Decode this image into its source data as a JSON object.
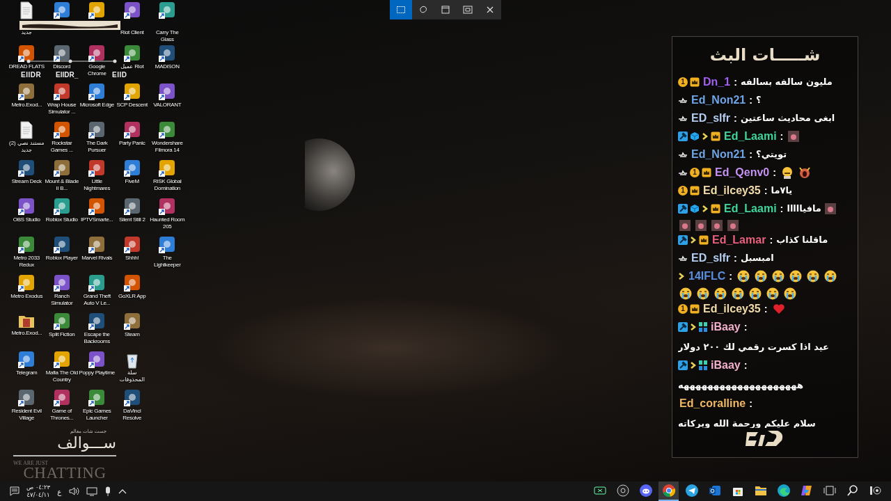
{
  "snip_toolbar": [
    {
      "kind": "rectangle",
      "selected": true
    },
    {
      "kind": "freeform",
      "selected": false
    },
    {
      "kind": "window",
      "selected": false
    },
    {
      "kind": "fullscreen",
      "selected": false
    },
    {
      "kind": "close",
      "selected": false
    }
  ],
  "desktop_rows": [
    [
      {
        "kind": "file",
        "label": "جديد"
      },
      {
        "kind": "app"
      },
      {
        "kind": "app"
      },
      {
        "kind": "app",
        "label": "Riot Client"
      },
      {
        "kind": "app",
        "label": "Carry The Glass"
      }
    ],
    [
      {
        "kind": "app",
        "label": "DREAD FLATS"
      },
      {
        "kind": "app",
        "label": "Discord"
      },
      {
        "kind": "app",
        "label": "Google Chrome"
      },
      {
        "kind": "app",
        "label": "عميل Riot"
      },
      {
        "kind": "app",
        "label": "MADiSON"
      }
    ],
    [
      {
        "kind": "app",
        "label": "Metro.Exod..."
      },
      {
        "kind": "app",
        "label": "Wrap House Simulator ..."
      },
      {
        "kind": "app",
        "label": "Microsoft Edge"
      },
      {
        "kind": "app",
        "label": "SCP Descent"
      },
      {
        "kind": "app",
        "label": "VALORANT"
      }
    ],
    [
      {
        "kind": "file",
        "label": "مستند نصي (2) جديد"
      },
      {
        "kind": "app",
        "label": "Rockstar Games ..."
      },
      {
        "kind": "app",
        "label": "The Dark Pursuer"
      },
      {
        "kind": "app",
        "label": "Party Panic"
      },
      {
        "kind": "app",
        "label": "Wondershare Filmora 14"
      }
    ],
    [
      {
        "kind": "app",
        "label": "Stream Deck"
      },
      {
        "kind": "app",
        "label": "Mount & Blade II B..."
      },
      {
        "kind": "app",
        "label": "Little Nightmares"
      },
      {
        "kind": "app",
        "label": "FiveM"
      },
      {
        "kind": "app",
        "label": "RISK Global Domination"
      }
    ],
    [
      {
        "kind": "app",
        "label": "OBS Studio"
      },
      {
        "kind": "app",
        "label": "Roblox Studio"
      },
      {
        "kind": "app",
        "label": "IPTVSmarte..."
      },
      {
        "kind": "app",
        "label": "Silent Still 2"
      },
      {
        "kind": "app",
        "label": "Haunted Room  205"
      }
    ],
    [
      {
        "kind": "app",
        "label": "Metro 2033 Redux"
      },
      {
        "kind": "app",
        "label": "Roblox Player"
      },
      {
        "kind": "app",
        "label": "Marvel Rivals"
      },
      {
        "kind": "app",
        "label": "Shhh!"
      },
      {
        "kind": "app",
        "label": "The Lightkeeper"
      }
    ],
    [
      {
        "kind": "app",
        "label": "Metro Exodus"
      },
      {
        "kind": "app",
        "label": "Ranch Simulator"
      },
      {
        "kind": "app",
        "label": "Grand Theft Auto V Le..."
      },
      {
        "kind": "app",
        "label": "GoXLR App"
      }
    ],
    [
      {
        "kind": "folder",
        "label": "Metro.Exod..."
      },
      {
        "kind": "app",
        "label": "Split Fiction"
      },
      {
        "kind": "app",
        "label": "Escape the Backrooms"
      },
      {
        "kind": "app",
        "label": "Steam"
      }
    ],
    [
      {
        "kind": "app",
        "label": "Telegram"
      },
      {
        "kind": "app",
        "label": "Mafia The Old Country"
      },
      {
        "kind": "app",
        "label": "Poppy Playtime"
      },
      {
        "kind": "recycle",
        "label": "سلة المحذوفات"
      }
    ],
    [
      {
        "kind": "app",
        "label": "Resident Evil Village"
      },
      {
        "kind": "app",
        "label": "Game of Thrones..."
      },
      {
        "kind": "app",
        "label": "Epic Games Launcher"
      },
      {
        "kind": "app",
        "label": "DaVinci Resolve"
      }
    ]
  ],
  "overlay_tags": [
    "EIIDR",
    "EIIDR_",
    "EIID"
  ],
  "brand": {
    "small": "جست شات معالم",
    "title": "ســـوالف",
    "tagline": "WE ARE JUST",
    "word": "CHATTING"
  },
  "chat": {
    "title": "شـــــات البث",
    "messages": [
      {
        "badges": [
          {
            "kind": "coin",
            "label": "1"
          },
          {
            "kind": "crown"
          }
        ],
        "user": "Dn_1",
        "color": "#a25ff0",
        "separator": ":",
        "text": "مليون سالفه بسالفه"
      },
      {
        "badges": [
          {
            "kind": "logo"
          }
        ],
        "user": "Ed_Non21",
        "color": "#6fa4e6",
        "separator": ":",
        "text": "؟"
      },
      {
        "badges": [
          {
            "kind": "logo"
          }
        ],
        "user": "ED_slfr",
        "color": "#b4cdf0",
        "separator": ":",
        "text": "ابغى محاديث ساعتين"
      },
      {
        "badges": [
          {
            "kind": "mod"
          },
          {
            "kind": "cube"
          },
          {
            "kind": "chevron"
          },
          {
            "kind": "crown"
          }
        ],
        "user": "Ed_Laami",
        "color": "#3fd69c",
        "separator": ":",
        "emotes": [
          {
            "kind": "photo"
          }
        ]
      },
      {
        "badges": [
          {
            "kind": "logo"
          }
        ],
        "user": "Ed_Non21",
        "color": "#6fa4e6",
        "separator": ":",
        "text": "تويتي؟"
      },
      {
        "badges": [
          {
            "kind": "logo"
          },
          {
            "kind": "coin",
            "label": "1"
          },
          {
            "kind": "crown"
          }
        ],
        "user": "Ed_Qenv0",
        "color": "#c492f0",
        "separator": ":",
        "emotes": [
          {
            "kind": "grin"
          },
          {
            "kind": "scream"
          }
        ]
      },
      {
        "badges": [
          {
            "kind": "coin",
            "label": "1"
          },
          {
            "kind": "crown"
          }
        ],
        "user": "Ed_ilcey35",
        "color": "#f2dcaa",
        "separator": ":",
        "text": "يا٧ما"
      },
      {
        "badges": [
          {
            "kind": "mod"
          },
          {
            "kind": "cube"
          },
          {
            "kind": "chevron"
          },
          {
            "kind": "crown"
          }
        ],
        "user": "Ed_Laami",
        "color": "#3fd69c",
        "separator": ":",
        "text": "مافيااااا",
        "emotes": [
          {
            "kind": "photo"
          },
          {
            "kind": "photo"
          },
          {
            "kind": "photo"
          },
          {
            "kind": "photo"
          },
          {
            "kind": "photo"
          }
        ]
      },
      {
        "badges": [
          {
            "kind": "mod"
          },
          {
            "kind": "chevron"
          },
          {
            "kind": "crown"
          }
        ],
        "user": "Ed_Lamar",
        "color": "#e8607e",
        "separator": ":",
        "text": "ماقلنا كذاب"
      },
      {
        "badges": [
          {
            "kind": "logo"
          }
        ],
        "user": "ED_slfr",
        "color": "#b4cdf0",
        "separator": ":",
        "text": "امبسبل"
      },
      {
        "badges": [
          {
            "kind": "chevron"
          }
        ],
        "user": "14IFLC",
        "color": "#5b8fe0",
        "separator": ":",
        "emotes": [
          {
            "kind": "sob"
          },
          {
            "kind": "sob"
          },
          {
            "kind": "sob"
          },
          {
            "kind": "sob"
          },
          {
            "kind": "sob"
          },
          {
            "kind": "sob"
          },
          {
            "kind": "sob"
          },
          {
            "kind": "sob"
          },
          {
            "kind": "sob"
          },
          {
            "kind": "sob"
          },
          {
            "kind": "sob"
          },
          {
            "kind": "sob"
          },
          {
            "kind": "sob"
          }
        ]
      },
      {
        "badges": [
          {
            "kind": "coin",
            "label": "1"
          },
          {
            "kind": "crown"
          }
        ],
        "user": "Ed_ilcey35",
        "color": "#f2dcaa",
        "separator": ":",
        "emotes": [
          {
            "kind": "heart"
          }
        ]
      },
      {
        "badges": [
          {
            "kind": "mod"
          },
          {
            "kind": "chevron"
          },
          {
            "kind": "grid"
          }
        ],
        "user": "iBaay",
        "color": "#f2b0cc",
        "separator": ":",
        "text": "عيد اذا كسرت رقمي لك ٢٠٠ دولار"
      },
      {
        "badges": [
          {
            "kind": "mod"
          },
          {
            "kind": "chevron"
          },
          {
            "kind": "grid"
          }
        ],
        "user": "iBaay",
        "color": "#f2b0cc",
        "separator": ":",
        "text": "ههههههههههههههههههههه"
      },
      {
        "user": "Ed_coralline",
        "color": "#f0b862",
        "separator": ":",
        "text": "سلام عليكم ورحمة الله وبركاته"
      }
    ]
  },
  "taskbar": {
    "tray": {
      "time": "٠٤:٢٣ ص",
      "date": "٤٧/٠٤/١١",
      "language": "ع"
    },
    "apps": [
      {
        "kind": "gamebar",
        "selected": false
      },
      {
        "kind": "obs",
        "selected": false
      },
      {
        "kind": "discord",
        "selected": false
      },
      {
        "kind": "chrome",
        "selected": true
      },
      {
        "kind": "telegram",
        "selected": false
      },
      {
        "kind": "outlook",
        "selected": false
      },
      {
        "kind": "store",
        "selected": false
      },
      {
        "kind": "explorer",
        "selected": false
      },
      {
        "kind": "edge",
        "selected": false
      },
      {
        "kind": "copilot",
        "selected": false
      },
      {
        "kind": "taskview",
        "selected": false
      },
      {
        "kind": "search",
        "selected": false
      },
      {
        "kind": "widgets",
        "selected": false
      }
    ]
  }
}
